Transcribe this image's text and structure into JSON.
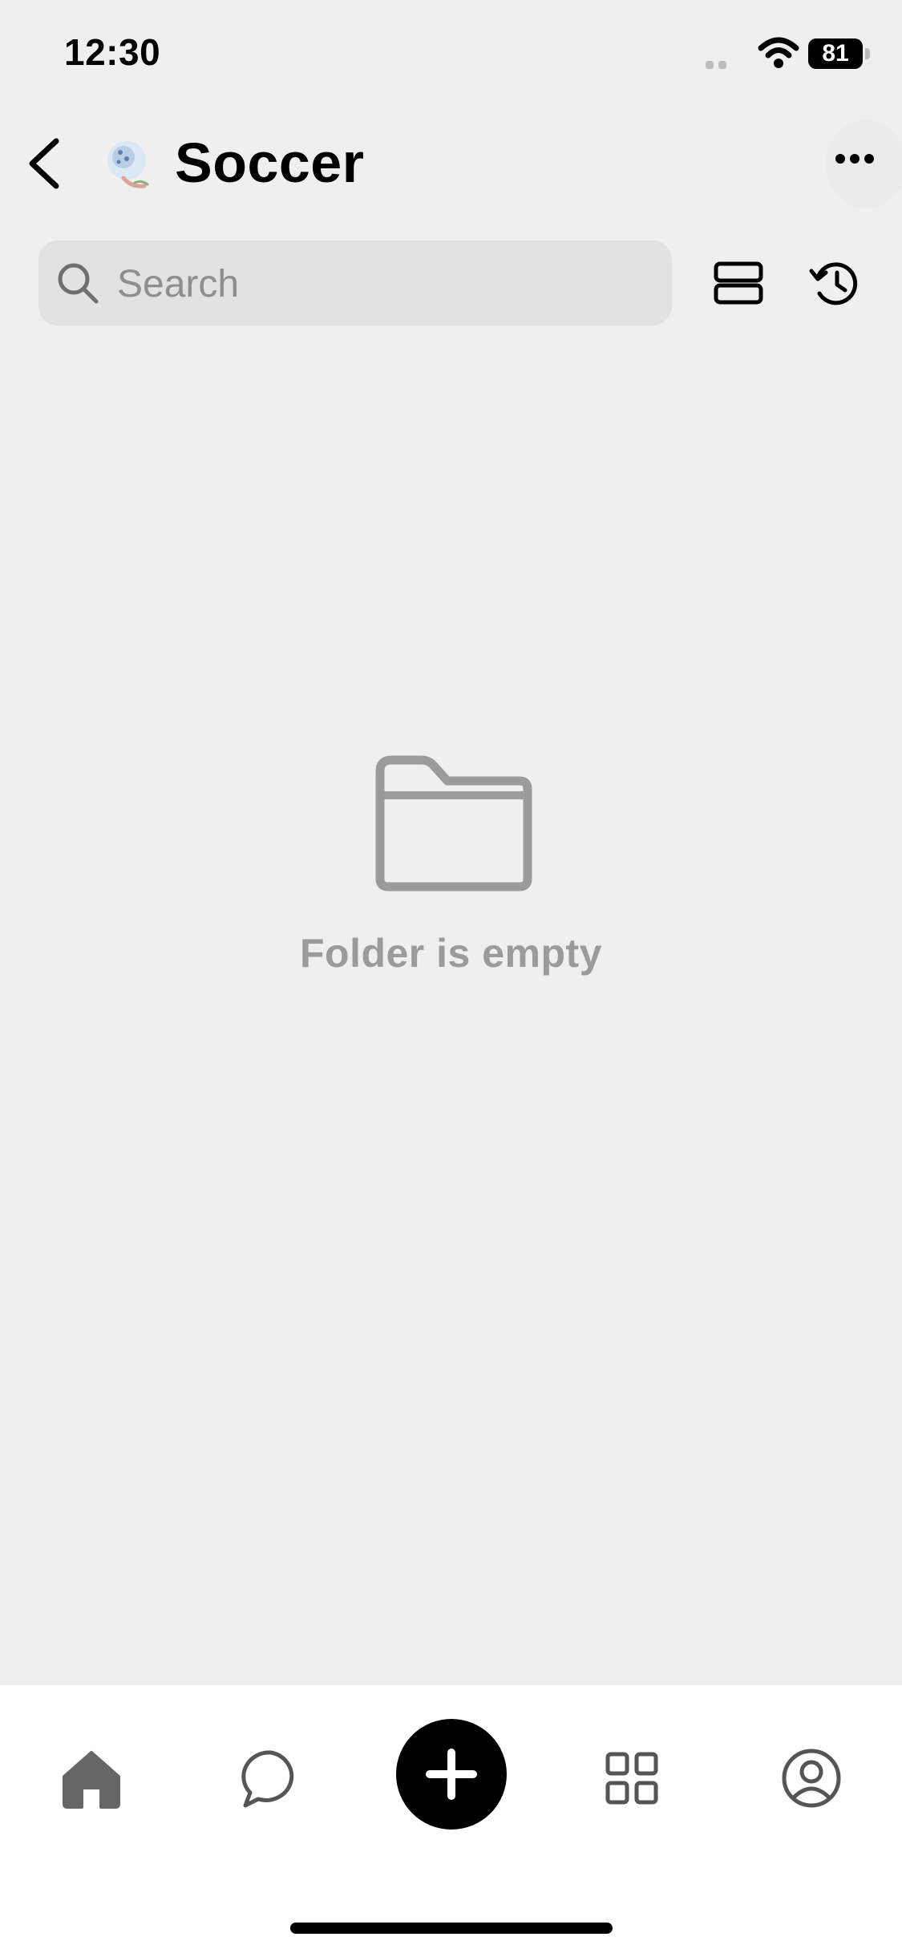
{
  "status_bar": {
    "time": "12:30",
    "battery_level": "81"
  },
  "header": {
    "title": "Soccer",
    "back_icon": "chevron-left-icon",
    "more_icon": "ellipsis-icon"
  },
  "search": {
    "placeholder": "Search"
  },
  "empty_state": {
    "icon": "folder-icon",
    "message": "Folder is empty"
  },
  "tabbar": {
    "items": [
      {
        "name": "home",
        "icon": "home-icon",
        "active": true
      },
      {
        "name": "chat",
        "icon": "chat-icon",
        "active": false
      },
      {
        "name": "create",
        "icon": "plus-icon",
        "active": false
      },
      {
        "name": "apps",
        "icon": "grid-icon",
        "active": false
      },
      {
        "name": "profile",
        "icon": "profile-icon",
        "active": false
      }
    ]
  },
  "colors": {
    "background": "#efefef",
    "search_bg": "#e2e2e2",
    "empty_text": "#9b9b9b",
    "tabbar_bg": "#ffffff",
    "accent": "#000000"
  }
}
